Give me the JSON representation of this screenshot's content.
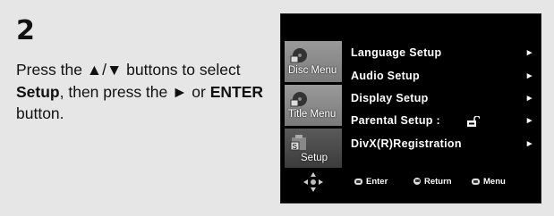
{
  "step": {
    "number": "2"
  },
  "instructions": {
    "part1": "Press the ▲/▼ buttons to select ",
    "bold1": "Setup",
    "part2": ", then press the ► or ",
    "bold2": "ENTER",
    "part3": " button."
  },
  "screen": {
    "tabs": [
      {
        "label": "Disc Menu",
        "icon": "disc-icon",
        "state": "inactive"
      },
      {
        "label": "Title Menu",
        "icon": "title-icon",
        "state": "inactive"
      },
      {
        "label": "Setup",
        "icon": "setup-icon",
        "state": "active"
      }
    ],
    "menu_items": [
      {
        "label": "Language Setup",
        "arrow": "►"
      },
      {
        "label": "Audio Setup",
        "arrow": "►"
      },
      {
        "label": "Display Setup",
        "arrow": "►"
      },
      {
        "label": "Parental Setup :",
        "arrow": "►",
        "icon": "lock-icon"
      },
      {
        "label": "DivX(R)Registration",
        "arrow": "►"
      }
    ],
    "bottom_bar": {
      "enter_label": "Enter",
      "return_label": "Return",
      "menu_label": "Menu"
    }
  },
  "colors": {
    "page_bg": "#e6e6e6",
    "screen_bg": "#000000",
    "tab_inactive": "#8a8a8a",
    "tab_active": "#4a4a4a"
  }
}
